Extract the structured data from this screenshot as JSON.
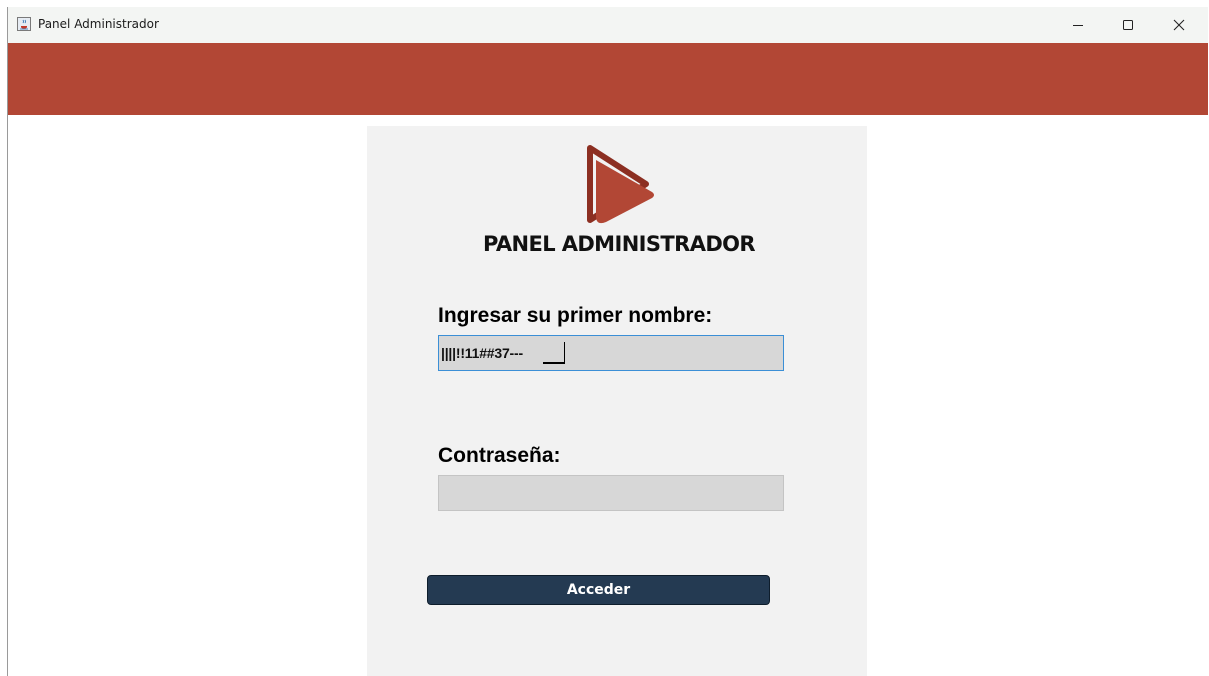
{
  "window": {
    "title": "Panel Administrador",
    "icons": {
      "app": "java-cup-icon",
      "minimize": "minimize-icon",
      "maximize": "maximize-icon",
      "close": "close-icon"
    }
  },
  "theme": {
    "header_color": "#b24735",
    "panel_color": "#f2f2f2",
    "button_color": "#243a52",
    "logo_color": "#b24735"
  },
  "login": {
    "logo_icon": "play-logo-icon",
    "heading": "PANEL ADMINISTRADOR",
    "username_label": "Ingresar su primer nombre:",
    "username_value": "||||!!11##37---",
    "password_label": "Contraseña:",
    "password_value": "",
    "submit_label": "Acceder"
  }
}
